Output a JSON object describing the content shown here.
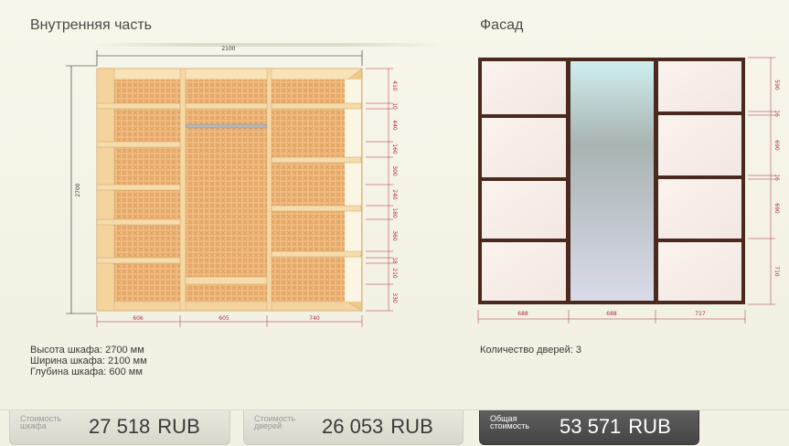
{
  "inner": {
    "title": "Внутренняя часть",
    "overall_width": "2100",
    "overall_height": "2700",
    "bottom_dims": [
      "606",
      "605",
      "740"
    ],
    "right_dims": [
      "410",
      "10",
      "440",
      "160",
      "300",
      "240",
      "180",
      "360",
      "18",
      "210",
      "330"
    ]
  },
  "facade": {
    "title": "Фасад",
    "bottom_dims": [
      "688",
      "688",
      "717"
    ],
    "right_dims": [
      "590",
      "16",
      "690",
      "16",
      "690",
      "710"
    ]
  },
  "specs": {
    "height": "Высота шкафа: 2700 мм",
    "width": "Ширина шкафа: 2100 мм",
    "depth": "Глубина шкафа: 600 мм"
  },
  "doors_count": "Количество дверей: 3",
  "prices": {
    "cabinet": {
      "caption_1": "Стоимость",
      "caption_2": "шкафа",
      "amount": "27 518",
      "currency": "RUB"
    },
    "doors": {
      "caption_1": "Стоимость",
      "caption_2": "дверей",
      "amount": "26 053",
      "currency": "RUB"
    },
    "total": {
      "caption_1": "Общая",
      "caption_2": "стоимость",
      "amount": "53 571",
      "currency": "RUB"
    }
  },
  "colors": {
    "background": "#f2f1e4",
    "wood": "#f2cf95",
    "facade_frame": "#4a2a1e",
    "mirror": "#c7cbcf",
    "dimension_red": "#b12a3c"
  }
}
